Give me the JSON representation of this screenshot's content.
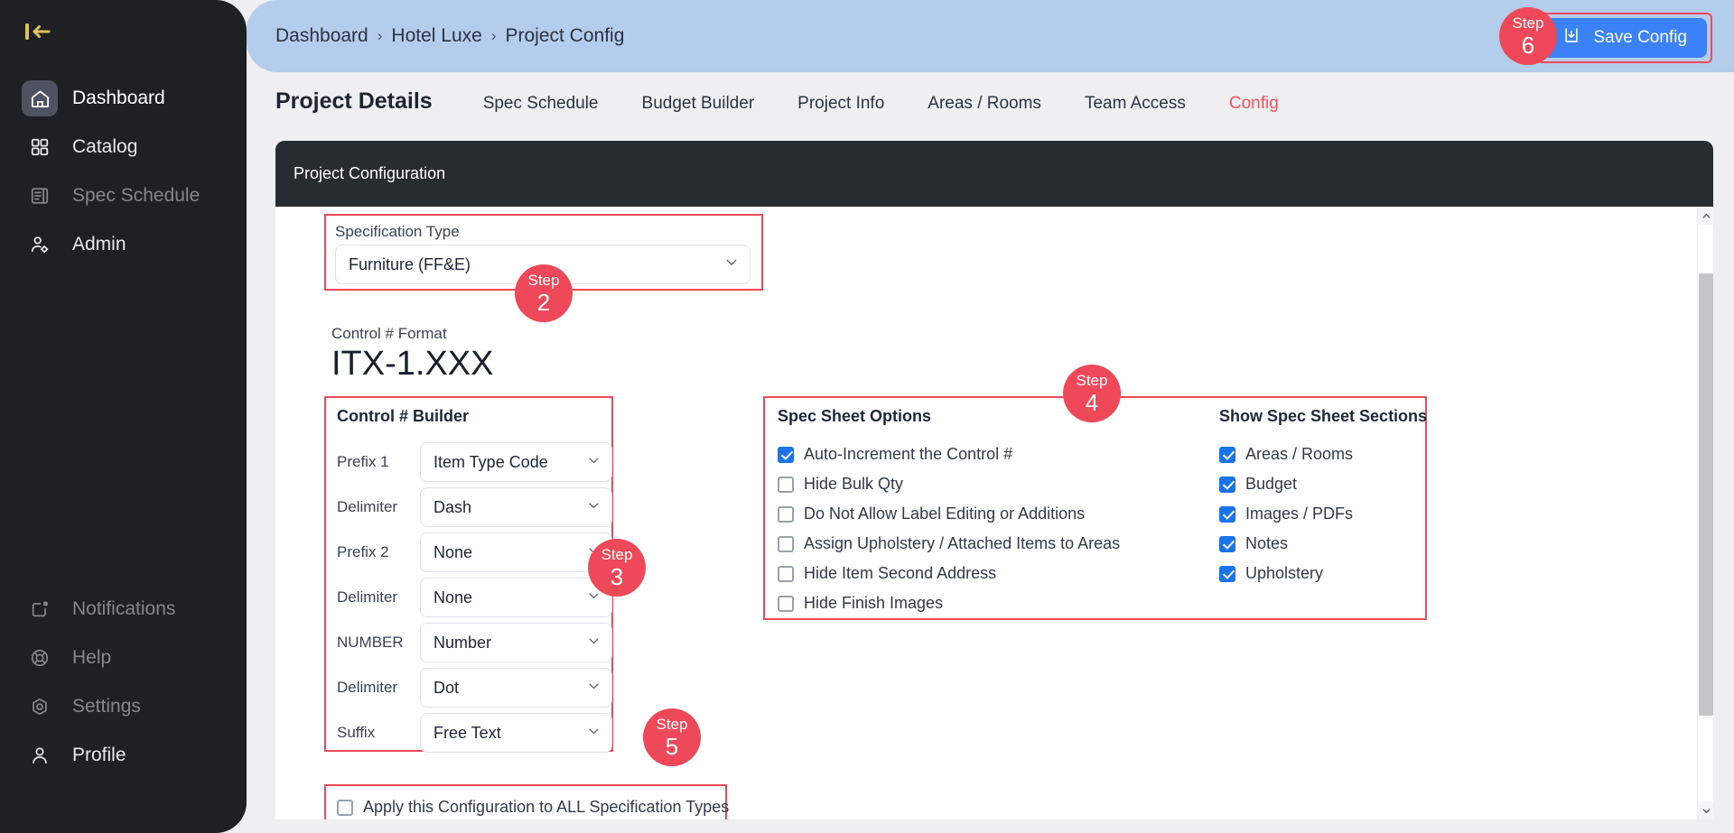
{
  "sidebar": {
    "collapse_icon": "collapse-sidebar-icon",
    "primary_items": [
      {
        "label": "Dashboard",
        "icon": "home-icon",
        "state": "active"
      },
      {
        "label": "Catalog",
        "icon": "grid-icon",
        "state": "bright"
      },
      {
        "label": "Spec Schedule",
        "icon": "document-list-icon",
        "state": "dim"
      },
      {
        "label": "Admin",
        "icon": "user-gear-icon",
        "state": "bright"
      }
    ],
    "secondary_items": [
      {
        "label": "Notifications",
        "icon": "notification-bell-icon",
        "state": "dim"
      },
      {
        "label": "Help",
        "icon": "life-ring-icon",
        "state": "dim"
      },
      {
        "label": "Settings",
        "icon": "gear-icon",
        "state": "dim"
      },
      {
        "label": "Profile",
        "icon": "person-icon",
        "state": "bright"
      }
    ]
  },
  "header": {
    "breadcrumb": [
      "Dashboard",
      "Hotel Luxe",
      "Project Config"
    ],
    "separator": "›",
    "save_label": "Save Config",
    "save_icon": "save-disk-icon"
  },
  "tabs": {
    "title": "Project Details",
    "items": [
      {
        "label": "Spec Schedule",
        "active": false
      },
      {
        "label": "Budget Builder",
        "active": false
      },
      {
        "label": "Project Info",
        "active": false
      },
      {
        "label": "Areas / Rooms",
        "active": false
      },
      {
        "label": "Team Access",
        "active": false
      },
      {
        "label": "Config",
        "active": true
      }
    ]
  },
  "card": {
    "header_title": "Project Configuration"
  },
  "spec_type": {
    "label": "Specification Type",
    "value": "Furniture (FF&E)"
  },
  "control_format": {
    "label": "Control # Format",
    "value": "ITX-1.XXX"
  },
  "builder": {
    "title": "Control # Builder",
    "rows": [
      {
        "label": "Prefix 1",
        "value": "Item Type Code"
      },
      {
        "label": "Delimiter",
        "value": "Dash"
      },
      {
        "label": "Prefix 2",
        "value": "None"
      },
      {
        "label": "Delimiter",
        "value": "None"
      },
      {
        "label": "NUMBER",
        "value": "Number"
      },
      {
        "label": "Delimiter",
        "value": "Dot"
      },
      {
        "label": "Suffix",
        "value": "Free Text"
      }
    ]
  },
  "spec_sheet_options": {
    "title": "Spec Sheet Options",
    "items": [
      {
        "label": "Auto-Increment the Control #",
        "checked": true
      },
      {
        "label": "Hide Bulk Qty",
        "checked": false
      },
      {
        "label": "Do Not Allow Label Editing or Additions",
        "checked": false
      },
      {
        "label": "Assign Upholstery / Attached Items to Areas",
        "checked": false
      },
      {
        "label": "Hide Item Second Address",
        "checked": false
      },
      {
        "label": "Hide Finish Images",
        "checked": false
      }
    ]
  },
  "spec_sheet_sections": {
    "title": "Show Spec Sheet Sections",
    "items": [
      {
        "label": "Areas / Rooms",
        "checked": true
      },
      {
        "label": "Budget",
        "checked": true
      },
      {
        "label": "Images / PDFs",
        "checked": true
      },
      {
        "label": "Notes",
        "checked": true
      },
      {
        "label": "Upholstery",
        "checked": true
      }
    ]
  },
  "apply_all": {
    "label": "Apply this Configuration to ALL Specification Types",
    "checked": false
  },
  "steps": [
    {
      "word": "Step",
      "num": "2"
    },
    {
      "word": "Step",
      "num": "3"
    },
    {
      "word": "Step",
      "num": "4"
    },
    {
      "word": "Step",
      "num": "5"
    },
    {
      "word": "Step",
      "num": "6"
    }
  ],
  "colors": {
    "accent_red": "#ef4858",
    "header_blue": "#b5cdec",
    "button_blue": "#3b82f6",
    "checkbox_blue": "#1a73e8",
    "sidebar_dark": "#1f2023",
    "card_header_dark": "#272c31",
    "tab_active_red": "#f4505f"
  }
}
